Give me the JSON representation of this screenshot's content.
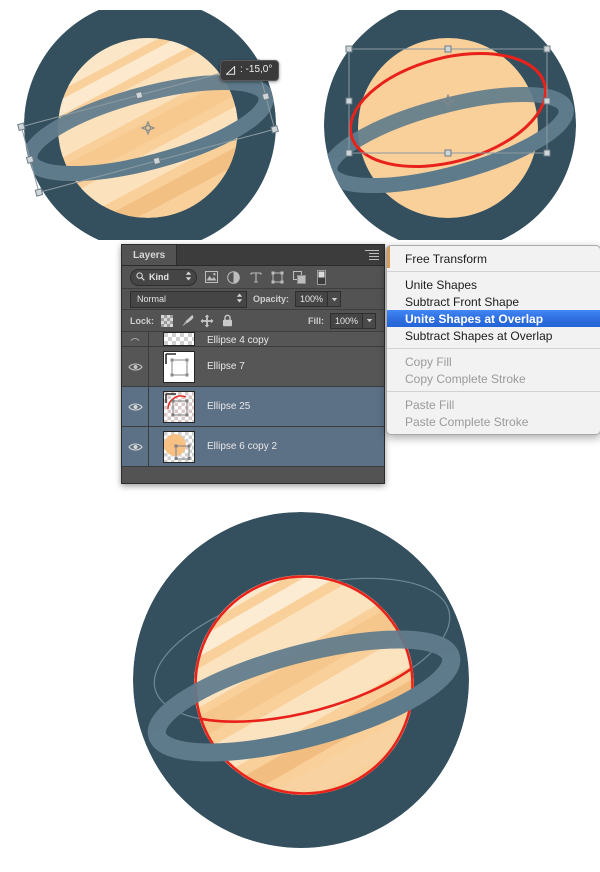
{
  "app": "Adobe Photoshop",
  "canvas": {
    "bg_color": "#ffffff",
    "planet_bg_circle": "#34505f",
    "planet_body": "#f9cf9a",
    "planet_highlight": "#fbe5c6",
    "planet_shadow": "#eab978",
    "ring_color": "#5e7b8c",
    "ring_back_color": "#4a6877",
    "path_stroke_red": "#e8221b",
    "transform_box_color": "#8c9aa2"
  },
  "tooltip": {
    "icon": "angle-icon",
    "label": "△",
    "value": ": -15,0°",
    "full": "△: -15,0°"
  },
  "layers_panel": {
    "tab_label": "Layers",
    "menu_icon": "panel-menu-icon",
    "filter": {
      "search_icon": "search-icon",
      "kind_label": "Kind",
      "stepper_icon": "updown-stepper-icon",
      "icons": [
        {
          "name": "filter-pixel-icon",
          "glyph": "image"
        },
        {
          "name": "filter-adjustment-icon",
          "glyph": "circle-half"
        },
        {
          "name": "filter-type-icon",
          "glyph": "T"
        },
        {
          "name": "filter-shape-icon",
          "glyph": "shape"
        },
        {
          "name": "filter-smart-object-icon",
          "glyph": "smartobject"
        },
        {
          "name": "filter-toggle-icon",
          "glyph": "switch"
        }
      ]
    },
    "blend": {
      "mode": "Normal",
      "opacity_label": "Opacity:",
      "opacity_value": "100%"
    },
    "lock": {
      "label": "Lock:",
      "icons": [
        {
          "name": "lock-transparency-icon"
        },
        {
          "name": "lock-image-icon"
        },
        {
          "name": "lock-position-icon"
        },
        {
          "name": "lock-all-icon"
        }
      ],
      "fill_label": "Fill:",
      "fill_value": "100%"
    },
    "rows": [
      {
        "name": "Ellipse 4 copy",
        "selected": false,
        "partial": true,
        "visible": true,
        "thumb": "checker"
      },
      {
        "name": "Ellipse 7",
        "selected": false,
        "partial": false,
        "visible": true,
        "thumb": "shape-only"
      },
      {
        "name": "Ellipse 25",
        "selected": true,
        "partial": false,
        "visible": true,
        "thumb": "red-arc"
      },
      {
        "name": "Ellipse 6 copy 2",
        "selected": true,
        "partial": false,
        "visible": true,
        "thumb": "orange-circle"
      }
    ]
  },
  "context_menu": {
    "items": [
      {
        "label": "Free Transform",
        "state": "normal"
      },
      {
        "label": "__SEP__",
        "state": "separator"
      },
      {
        "label": "Unite Shapes",
        "state": "normal"
      },
      {
        "label": "Subtract Front Shape",
        "state": "normal"
      },
      {
        "label": "Unite Shapes at Overlap",
        "state": "active"
      },
      {
        "label": "Subtract Shapes at Overlap",
        "state": "normal"
      },
      {
        "label": "__SEP__",
        "state": "separator"
      },
      {
        "label": "Copy Fill",
        "state": "disabled"
      },
      {
        "label": "Copy Complete Stroke",
        "state": "disabled"
      },
      {
        "label": "__SEP__",
        "state": "separator"
      },
      {
        "label": "Paste Fill",
        "state": "disabled"
      },
      {
        "label": "Paste Complete Stroke",
        "state": "disabled"
      }
    ],
    "highlight_color": "#2f6fe0"
  }
}
